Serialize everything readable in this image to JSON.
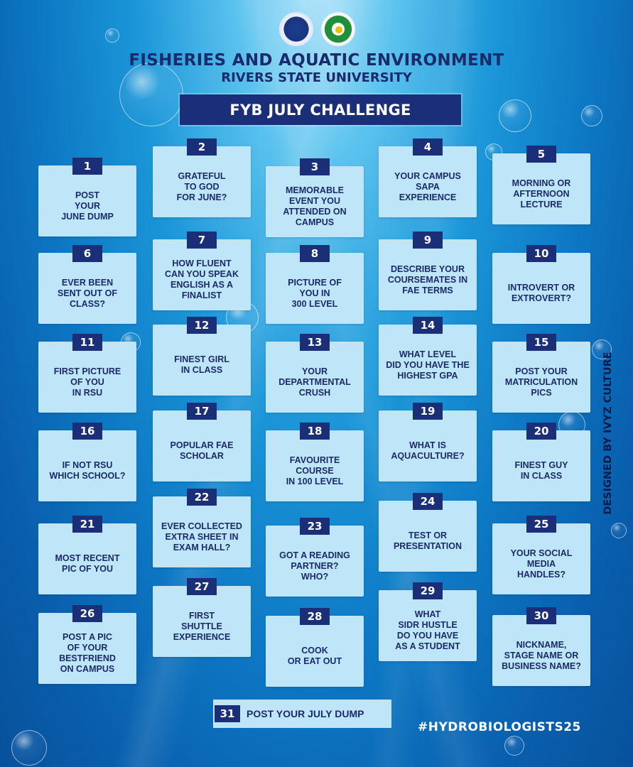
{
  "header": {
    "title": "FISHERIES AND AQUATIC ENVIRONMENT",
    "subtitle": "RIVERS STATE UNIVERSITY",
    "banner": "FYB JULY CHALLENGE"
  },
  "challenges": [
    {
      "num": "1",
      "text": "POST\nYOUR\nJUNE DUMP"
    },
    {
      "num": "2",
      "text": "GRATEFUL\nTO GOD\nFOR JUNE?"
    },
    {
      "num": "3",
      "text": "MEMORABLE\nEVENT YOU\nATTENDED ON\nCAMPUS"
    },
    {
      "num": "4",
      "text": "YOUR CAMPUS\nSAPA\nEXPERIENCE"
    },
    {
      "num": "5",
      "text": "MORNING OR\nAFTERNOON\nLECTURE"
    },
    {
      "num": "6",
      "text": "EVER BEEN\nSENT OUT OF\nCLASS?"
    },
    {
      "num": "7",
      "text": "HOW FLUENT\nCAN YOU SPEAK\nENGLISH AS A\nFINALIST"
    },
    {
      "num": "8",
      "text": "PICTURE OF\nYOU IN\n300 LEVEL"
    },
    {
      "num": "9",
      "text": "DESCRIBE YOUR\nCOURSEMATES IN\nFAE TERMS"
    },
    {
      "num": "10",
      "text": "INTROVERT OR\nEXTROVERT?"
    },
    {
      "num": "11",
      "text": "FIRST PICTURE\nOF YOU\nIN RSU"
    },
    {
      "num": "12",
      "text": "FINEST GIRL\nIN CLASS"
    },
    {
      "num": "13",
      "text": "YOUR\nDEPARTMENTAL\nCRUSH"
    },
    {
      "num": "14",
      "text": "WHAT LEVEL\nDID YOU HAVE THE\nHIGHEST GPA"
    },
    {
      "num": "15",
      "text": "POST YOUR\nMATRICULATION\nPICS"
    },
    {
      "num": "16",
      "text": "IF NOT RSU\nWHICH SCHOOL?"
    },
    {
      "num": "17",
      "text": "POPULAR FAE\nSCHOLAR"
    },
    {
      "num": "18",
      "text": "FAVOURITE\nCOURSE\nIN 100 LEVEL"
    },
    {
      "num": "19",
      "text": "WHAT IS\nAQUACULTURE?"
    },
    {
      "num": "20",
      "text": "FINEST GUY\nIN CLASS"
    },
    {
      "num": "21",
      "text": "MOST RECENT\nPIC OF YOU"
    },
    {
      "num": "22",
      "text": "EVER COLLECTED\nEXTRA SHEET IN\nEXAM HALL?"
    },
    {
      "num": "23",
      "text": "GOT A READING\nPARTNER?\nWHO?"
    },
    {
      "num": "24",
      "text": "TEST OR\nPRESENTATION"
    },
    {
      "num": "25",
      "text": "YOUR SOCIAL\nMEDIA\nHANDLES?"
    },
    {
      "num": "26",
      "text": "POST A PIC\nOF YOUR\nBESTFRIEND\nON CAMPUS"
    },
    {
      "num": "27",
      "text": "FIRST\nSHUTTLE\nEXPERIENCE"
    },
    {
      "num": "28",
      "text": "COOK\nOR EAT OUT"
    },
    {
      "num": "29",
      "text": "WHAT\nSIDR HUSTLE\nDO YOU HAVE\nAS A STUDENT"
    },
    {
      "num": "30",
      "text": "NICKNAME,\nSTAGE NAME OR\nBUSINESS NAME?"
    }
  ],
  "final_challenge": {
    "num": "31",
    "text": "POST YOUR JULY DUMP"
  },
  "credit": "DESIGNED BY IVYZ CULTURE",
  "hashtag": "#HYDROBIOLOGISTS25",
  "colors": {
    "navy": "#1a2f78",
    "card": "#bfe5f8",
    "text": "#1b2a6b"
  },
  "logos": [
    "department-logo",
    "university-logo"
  ]
}
